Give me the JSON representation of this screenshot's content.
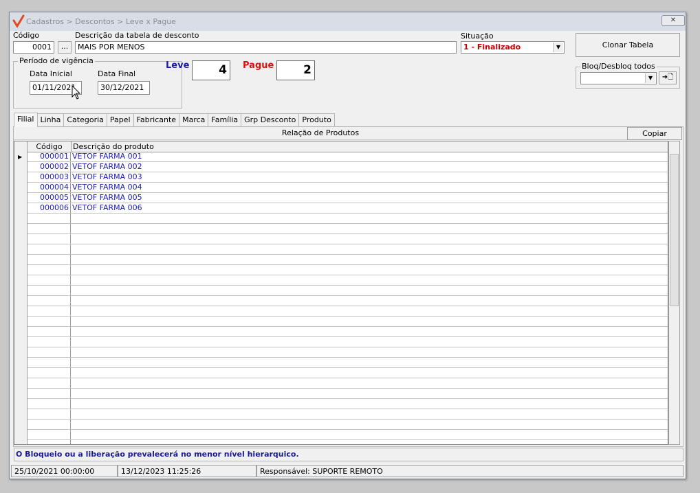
{
  "window": {
    "title": "Cadastros > Descontos > Leve x Pague",
    "close_glyph": "✕"
  },
  "header": {
    "codigo_label": "Código",
    "codigo_value": "0001",
    "lookup_label": "...",
    "descricao_label": "Descrição da tabela de desconto",
    "descricao_value": "MAIS POR MENOS",
    "situacao_label": "Situação",
    "situacao_value": "1 - Finalizado",
    "clonar_label": "Clonar Tabela"
  },
  "vigencia": {
    "group_title": "Período de vigência",
    "inicial_label": "Data Inicial",
    "inicial_value": "01/11/2021",
    "final_label": "Data Final",
    "final_value": "30/12/2021"
  },
  "leve": {
    "label": "Leve",
    "value": "4"
  },
  "pague": {
    "label": "Pague",
    "value": "2"
  },
  "bloq": {
    "group_title": "Bloq/Desbloq todos",
    "select_value": "",
    "apply_glyph": "➜🗋"
  },
  "tabs": [
    {
      "label": "Filial"
    },
    {
      "label": "Linha"
    },
    {
      "label": "Categoria"
    },
    {
      "label": "Papel"
    },
    {
      "label": "Fabricante"
    },
    {
      "label": "Marca"
    },
    {
      "label": "Família"
    },
    {
      "label": "Grp Desconto"
    },
    {
      "label": "Produto"
    }
  ],
  "panel": {
    "title": "Relação de Produtos",
    "copy_label": "Copiar"
  },
  "grid": {
    "columns": [
      "Código",
      "Descrição do produto"
    ],
    "rows": [
      {
        "codigo": "000001",
        "descricao": "VETOF FARMA 001"
      },
      {
        "codigo": "000002",
        "descricao": "VETOF FARMA 002"
      },
      {
        "codigo": "000003",
        "descricao": "VETOF FARMA 003"
      },
      {
        "codigo": "000004",
        "descricao": "VETOF FARMA 004"
      },
      {
        "codigo": "000005",
        "descricao": "VETOF FARMA 005"
      },
      {
        "codigo": "000006",
        "descricao": "VETOF FARMA 006"
      }
    ]
  },
  "footer_note": "O Bloqueio ou a liberação prevalecerá no menor nível hierarquico.",
  "statusbar": {
    "created": "25/10/2021 00:00:00",
    "modified": "13/12/2023 11:25:26",
    "responsavel": "Responsável: SUPORTE REMOTO"
  },
  "colors": {
    "leve": "#1a1ab8",
    "pague": "#e01010",
    "situacao": "#cc0000",
    "grid_text": "#1a1ab8",
    "footer_note": "#1a1aa0"
  }
}
